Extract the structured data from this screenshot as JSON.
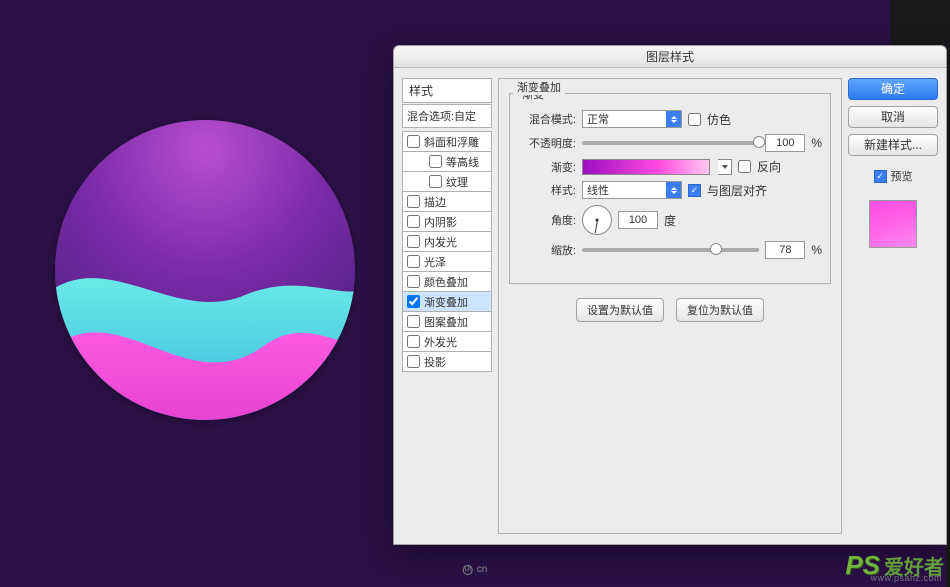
{
  "dialog": {
    "title": "图层样式"
  },
  "styles": {
    "header": "样式",
    "blending": "混合选项:自定",
    "items": [
      {
        "label": "斜面和浮雕",
        "checked": false,
        "indent": false
      },
      {
        "label": "等高线",
        "checked": false,
        "indent": true
      },
      {
        "label": "纹理",
        "checked": false,
        "indent": true
      },
      {
        "label": "描边",
        "checked": false,
        "indent": false
      },
      {
        "label": "内阴影",
        "checked": false,
        "indent": false
      },
      {
        "label": "内发光",
        "checked": false,
        "indent": false
      },
      {
        "label": "光泽",
        "checked": false,
        "indent": false
      },
      {
        "label": "颜色叠加",
        "checked": false,
        "indent": false
      },
      {
        "label": "渐变叠加",
        "checked": true,
        "indent": false
      },
      {
        "label": "图案叠加",
        "checked": false,
        "indent": false
      },
      {
        "label": "外发光",
        "checked": false,
        "indent": false
      },
      {
        "label": "投影",
        "checked": false,
        "indent": false
      }
    ]
  },
  "panel": {
    "section_title": "渐变叠加",
    "gradient_group": "渐变",
    "blend_mode_label": "混合模式:",
    "blend_mode_value": "正常",
    "dither_label": "仿色",
    "opacity_label": "不透明度:",
    "opacity_value": "100",
    "percent": "%",
    "gradient_label": "渐变:",
    "reverse_label": "反向",
    "style_label": "样式:",
    "style_value": "线性",
    "align_label": "与图层对齐",
    "angle_label": "角度:",
    "angle_value": "100",
    "degree": "度",
    "scale_label": "缩放:",
    "scale_value": "78",
    "set_default": "设置为默认值",
    "reset_default": "复位为默认值"
  },
  "buttons": {
    "ok": "确定",
    "cancel": "取消",
    "new_style": "新建样式...",
    "preview": "预览"
  },
  "watermark": {
    "ps": "PS",
    "cn": "爱好者",
    "url": "www.psahz.com"
  },
  "footer_note": "cn"
}
